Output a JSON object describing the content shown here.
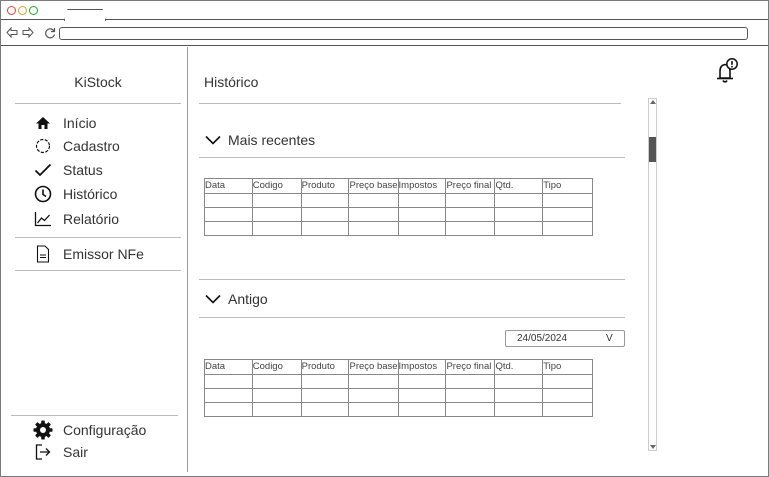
{
  "app": {
    "brand": "KiStock"
  },
  "sidebar": {
    "items": [
      {
        "label": "Início",
        "icon": "home-icon"
      },
      {
        "label": "Cadastro",
        "icon": "circle-dashed-icon"
      },
      {
        "label": "Status",
        "icon": "check-icon"
      },
      {
        "label": "Histórico",
        "icon": "clock-icon"
      },
      {
        "label": "Relatório",
        "icon": "chart-line-icon"
      }
    ],
    "nfe": {
      "label": "Emissor NFe",
      "icon": "document-icon"
    },
    "bottom": [
      {
        "label": "Configuração",
        "icon": "gear-icon"
      },
      {
        "label": "Sair",
        "icon": "logout-icon"
      }
    ]
  },
  "main": {
    "title": "Histórico",
    "sections": [
      {
        "label": "Mais recentes"
      },
      {
        "label": "Antigo",
        "date_filter": {
          "value": "24/05/2024",
          "arrow": "V"
        }
      }
    ],
    "table_columns": [
      "Data",
      "Codigo",
      "Produto",
      "Preço base",
      "Impostos",
      "Preço final",
      "Qtd.",
      "Tipo"
    ]
  },
  "colors": {
    "dot_red": "#e0443e",
    "dot_yellow": "#dea123",
    "dot_green": "#1aab29"
  }
}
